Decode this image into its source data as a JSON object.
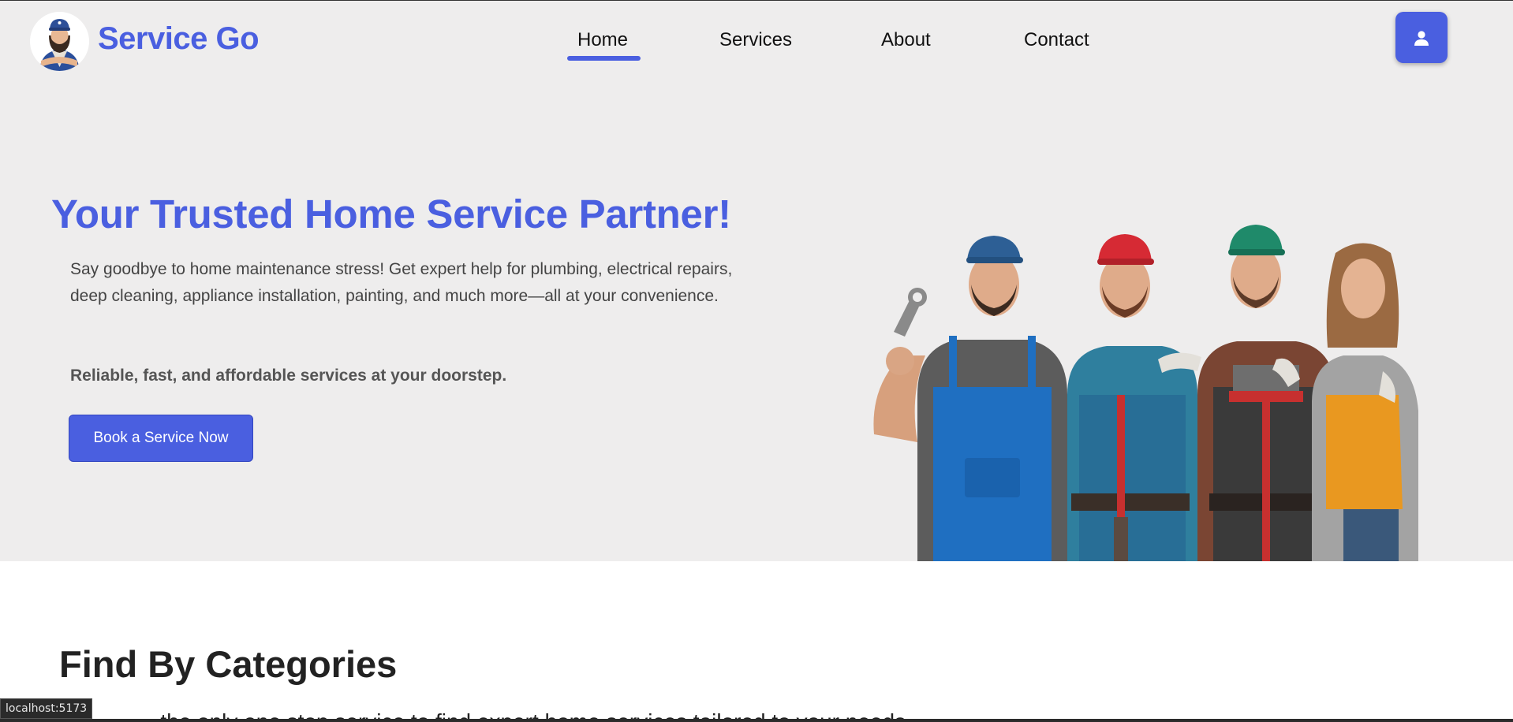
{
  "brand": {
    "name": "Service Go",
    "color": "#4a5fe0"
  },
  "nav": {
    "items": [
      {
        "label": "Home",
        "active": true
      },
      {
        "label": "Services",
        "active": false
      },
      {
        "label": "About",
        "active": false
      },
      {
        "label": "Contact",
        "active": false
      }
    ],
    "profile_icon": "user-icon"
  },
  "hero": {
    "title": "Your Trusted Home Service Partner!",
    "description": "Say goodbye to home maintenance stress! Get expert help for plumbing, electrical repairs, deep cleaning, appliance installation, painting, and much more—all at your convenience.",
    "tagline": "Reliable, fast, and affordable services at your doorstep.",
    "cta_label": "Book a Service Now"
  },
  "categories": {
    "title": "Find By Categories",
    "subtitle": "...the only one stop service to find expert home services tailored to your needs"
  },
  "status_bar": {
    "url": "localhost:5173"
  }
}
